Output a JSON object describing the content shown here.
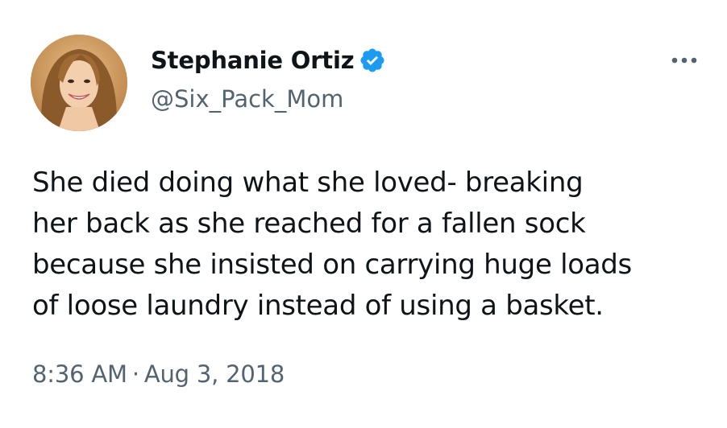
{
  "tweet": {
    "author": {
      "display_name": "Stephanie Ortiz",
      "handle": "@Six_Pack_Mom",
      "verified_icon": "verified-badge-icon",
      "avatar_icon": "profile-photo"
    },
    "more_icon": "more-options-icon",
    "text_lines": [
      "She died doing what she loved- breaking",
      "her back as she reached for a fallen sock",
      "because she insisted on carrying huge loads",
      "of loose laundry instead of using a basket."
    ],
    "time": "8:36 AM",
    "separator": "·",
    "date": "Aug 3, 2018"
  },
  "colors": {
    "text_primary": "#0f1419",
    "text_secondary": "#536471",
    "verified_blue": "#1d9bf0",
    "background": "#ffffff"
  }
}
